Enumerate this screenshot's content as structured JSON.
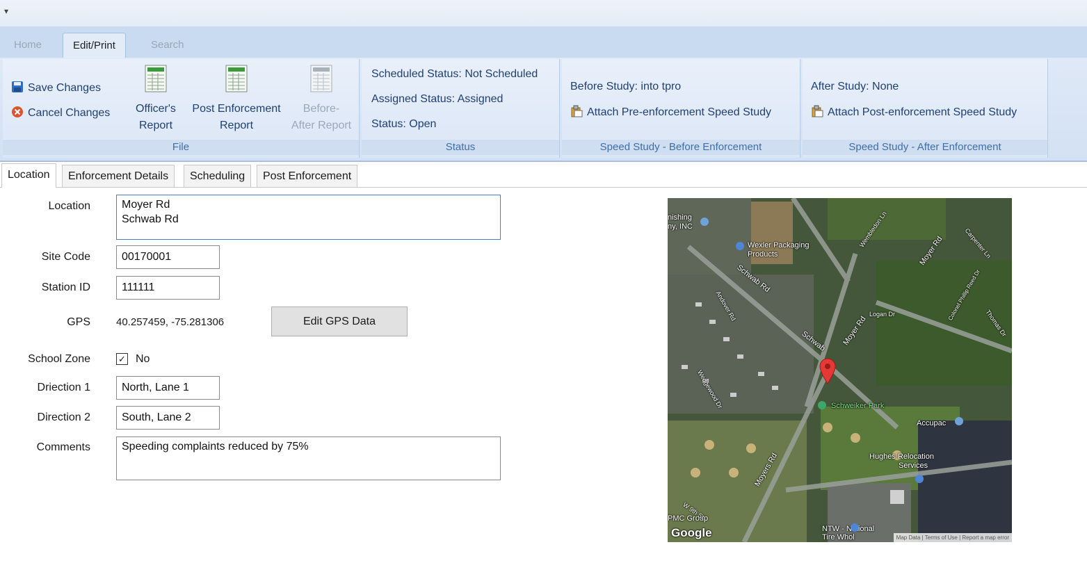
{
  "qat": {
    "icon": "customize-qat-icon",
    "glyph": "▾"
  },
  "ribbon_tabs": [
    "Home",
    "Edit/Print",
    "Search"
  ],
  "file_group": {
    "save_label": "Save Changes",
    "cancel_label": "Cancel Changes",
    "officer_report_line1": "Officer's",
    "officer_report_line2": "Report",
    "post_report_line1": "Post Enforcement",
    "post_report_line2": "Report",
    "before_after_line1": "Before-",
    "before_after_line2": "After Report",
    "label": "File"
  },
  "status_group": {
    "scheduled": "Scheduled Status: Not Scheduled",
    "assigned": "Assigned Status: Assigned",
    "status": "Status: Open",
    "label": "Status"
  },
  "before_group": {
    "study": "Before Study: into tpro",
    "attach": "Attach Pre-enforcement Speed Study",
    "label": "Speed Study - Before Enforcement"
  },
  "after_group": {
    "study": "After Study: None",
    "attach": "Attach Post-enforcement Speed Study",
    "label": "Speed Study - After Enforcement"
  },
  "content_tabs": [
    "Location",
    "Enforcement Details",
    "Scheduling",
    "Post Enforcement"
  ],
  "form": {
    "location_label": "Location",
    "location_line1": "Moyer Rd",
    "location_line2": "Schwab Rd",
    "site_code_label": "Site Code",
    "site_code": "00170001",
    "station_id_label": "Station ID",
    "station_id": "111111",
    "gps_label": "GPS",
    "gps_value": "40.257459, -75.281306",
    "edit_gps_label": "Edit GPS Data",
    "school_zone_label": "School Zone",
    "school_zone_value": "No",
    "school_zone_checked": true,
    "direction1_label": "Driection 1",
    "direction1": "North, Lane 1",
    "direction2_label": "Direction 2",
    "direction2": "South, Lane 2",
    "comments_label": "Comments",
    "comments": "Speeding complaints reduced by 75%"
  },
  "map": {
    "labels": [
      "nishing",
      "ny, INC",
      "Wexler Packaging",
      "Products",
      "Schwab Rd",
      "Moyer Rd",
      "Schwab",
      "Moyer Rd",
      "Schweiker Park",
      "Accupac",
      "Hughes Relocation",
      "Services",
      "Moyers Rd",
      "PMC Group",
      "NTW - National",
      "Tire Whol",
      "Google",
      "Map Data",
      "Terms of Use",
      "Report a map error",
      "Wembledon Ln",
      "Logan Dr",
      "Colonel Phillip Reed Dr",
      "Thomas Dr",
      "Carpenter Ln",
      "Andover Rd",
      "Wedgewood Dr",
      "W 9th St"
    ]
  },
  "colors": {
    "accent": "#1f3f75",
    "group_label": "#3f6ea6",
    "ribbon_bg": "#dbe6f6",
    "pin": "#e53935"
  }
}
